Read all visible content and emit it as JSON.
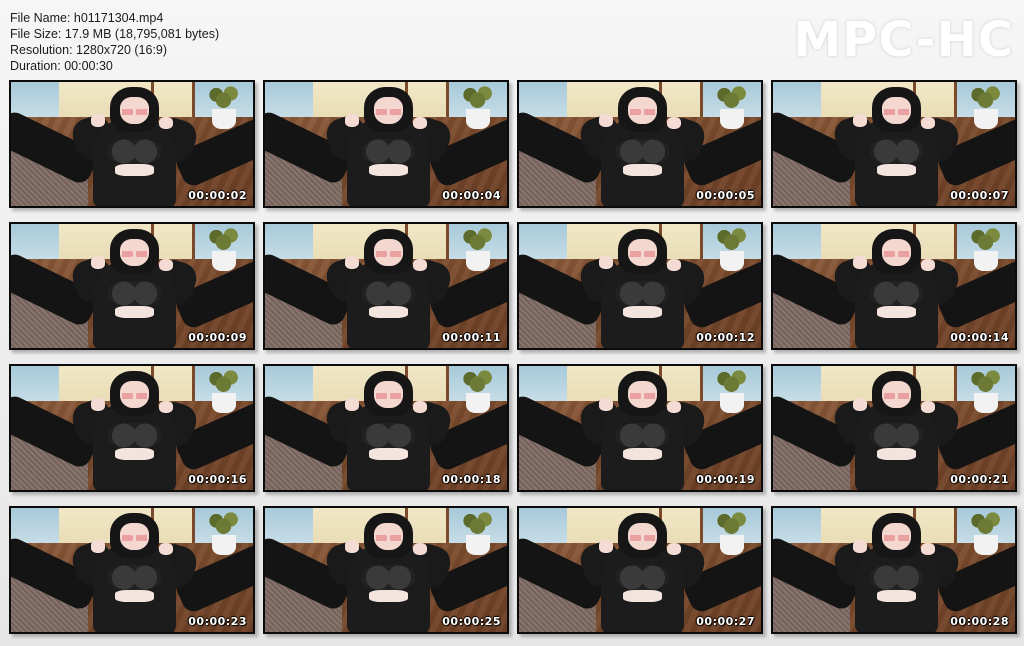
{
  "file_info": {
    "name_line": "File Name: h01171304.mp4",
    "size_line": "File Size: 17.9 MB (18,795,081 bytes)",
    "resolution_line": "Resolution: 1280x720 (16:9)",
    "duration_line": "Duration: 00:00:30"
  },
  "watermark": "MPC-HC",
  "thumbnails": [
    {
      "timestamp": "00:00:02"
    },
    {
      "timestamp": "00:00:04"
    },
    {
      "timestamp": "00:00:05"
    },
    {
      "timestamp": "00:00:07"
    },
    {
      "timestamp": "00:00:09"
    },
    {
      "timestamp": "00:00:11"
    },
    {
      "timestamp": "00:00:12"
    },
    {
      "timestamp": "00:00:14"
    },
    {
      "timestamp": "00:00:16"
    },
    {
      "timestamp": "00:00:18"
    },
    {
      "timestamp": "00:00:19"
    },
    {
      "timestamp": "00:00:21"
    },
    {
      "timestamp": "00:00:23"
    },
    {
      "timestamp": "00:00:25"
    },
    {
      "timestamp": "00:00:27"
    },
    {
      "timestamp": "00:00:28"
    }
  ]
}
